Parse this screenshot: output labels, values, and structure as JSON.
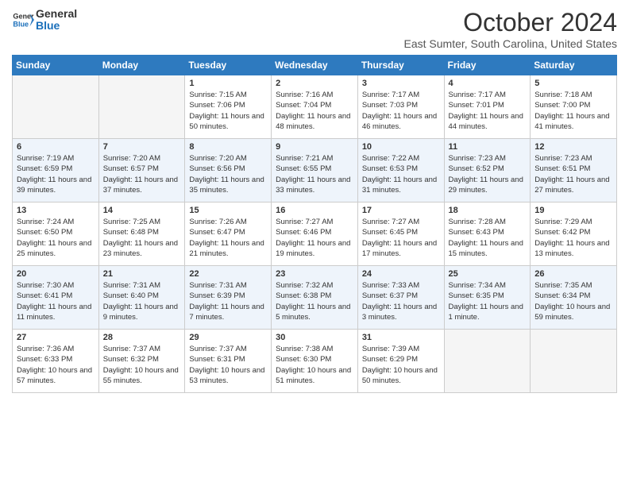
{
  "header": {
    "logo_line1": "General",
    "logo_line2": "Blue",
    "month_title": "October 2024",
    "subtitle": "East Sumter, South Carolina, United States"
  },
  "days_of_week": [
    "Sunday",
    "Monday",
    "Tuesday",
    "Wednesday",
    "Thursday",
    "Friday",
    "Saturday"
  ],
  "weeks": [
    [
      {
        "day": "",
        "info": ""
      },
      {
        "day": "",
        "info": ""
      },
      {
        "day": "1",
        "info": "Sunrise: 7:15 AM\nSunset: 7:06 PM\nDaylight: 11 hours and 50 minutes."
      },
      {
        "day": "2",
        "info": "Sunrise: 7:16 AM\nSunset: 7:04 PM\nDaylight: 11 hours and 48 minutes."
      },
      {
        "day": "3",
        "info": "Sunrise: 7:17 AM\nSunset: 7:03 PM\nDaylight: 11 hours and 46 minutes."
      },
      {
        "day": "4",
        "info": "Sunrise: 7:17 AM\nSunset: 7:01 PM\nDaylight: 11 hours and 44 minutes."
      },
      {
        "day": "5",
        "info": "Sunrise: 7:18 AM\nSunset: 7:00 PM\nDaylight: 11 hours and 41 minutes."
      }
    ],
    [
      {
        "day": "6",
        "info": "Sunrise: 7:19 AM\nSunset: 6:59 PM\nDaylight: 11 hours and 39 minutes."
      },
      {
        "day": "7",
        "info": "Sunrise: 7:20 AM\nSunset: 6:57 PM\nDaylight: 11 hours and 37 minutes."
      },
      {
        "day": "8",
        "info": "Sunrise: 7:20 AM\nSunset: 6:56 PM\nDaylight: 11 hours and 35 minutes."
      },
      {
        "day": "9",
        "info": "Sunrise: 7:21 AM\nSunset: 6:55 PM\nDaylight: 11 hours and 33 minutes."
      },
      {
        "day": "10",
        "info": "Sunrise: 7:22 AM\nSunset: 6:53 PM\nDaylight: 11 hours and 31 minutes."
      },
      {
        "day": "11",
        "info": "Sunrise: 7:23 AM\nSunset: 6:52 PM\nDaylight: 11 hours and 29 minutes."
      },
      {
        "day": "12",
        "info": "Sunrise: 7:23 AM\nSunset: 6:51 PM\nDaylight: 11 hours and 27 minutes."
      }
    ],
    [
      {
        "day": "13",
        "info": "Sunrise: 7:24 AM\nSunset: 6:50 PM\nDaylight: 11 hours and 25 minutes."
      },
      {
        "day": "14",
        "info": "Sunrise: 7:25 AM\nSunset: 6:48 PM\nDaylight: 11 hours and 23 minutes."
      },
      {
        "day": "15",
        "info": "Sunrise: 7:26 AM\nSunset: 6:47 PM\nDaylight: 11 hours and 21 minutes."
      },
      {
        "day": "16",
        "info": "Sunrise: 7:27 AM\nSunset: 6:46 PM\nDaylight: 11 hours and 19 minutes."
      },
      {
        "day": "17",
        "info": "Sunrise: 7:27 AM\nSunset: 6:45 PM\nDaylight: 11 hours and 17 minutes."
      },
      {
        "day": "18",
        "info": "Sunrise: 7:28 AM\nSunset: 6:43 PM\nDaylight: 11 hours and 15 minutes."
      },
      {
        "day": "19",
        "info": "Sunrise: 7:29 AM\nSunset: 6:42 PM\nDaylight: 11 hours and 13 minutes."
      }
    ],
    [
      {
        "day": "20",
        "info": "Sunrise: 7:30 AM\nSunset: 6:41 PM\nDaylight: 11 hours and 11 minutes."
      },
      {
        "day": "21",
        "info": "Sunrise: 7:31 AM\nSunset: 6:40 PM\nDaylight: 11 hours and 9 minutes."
      },
      {
        "day": "22",
        "info": "Sunrise: 7:31 AM\nSunset: 6:39 PM\nDaylight: 11 hours and 7 minutes."
      },
      {
        "day": "23",
        "info": "Sunrise: 7:32 AM\nSunset: 6:38 PM\nDaylight: 11 hours and 5 minutes."
      },
      {
        "day": "24",
        "info": "Sunrise: 7:33 AM\nSunset: 6:37 PM\nDaylight: 11 hours and 3 minutes."
      },
      {
        "day": "25",
        "info": "Sunrise: 7:34 AM\nSunset: 6:35 PM\nDaylight: 11 hours and 1 minute."
      },
      {
        "day": "26",
        "info": "Sunrise: 7:35 AM\nSunset: 6:34 PM\nDaylight: 10 hours and 59 minutes."
      }
    ],
    [
      {
        "day": "27",
        "info": "Sunrise: 7:36 AM\nSunset: 6:33 PM\nDaylight: 10 hours and 57 minutes."
      },
      {
        "day": "28",
        "info": "Sunrise: 7:37 AM\nSunset: 6:32 PM\nDaylight: 10 hours and 55 minutes."
      },
      {
        "day": "29",
        "info": "Sunrise: 7:37 AM\nSunset: 6:31 PM\nDaylight: 10 hours and 53 minutes."
      },
      {
        "day": "30",
        "info": "Sunrise: 7:38 AM\nSunset: 6:30 PM\nDaylight: 10 hours and 51 minutes."
      },
      {
        "day": "31",
        "info": "Sunrise: 7:39 AM\nSunset: 6:29 PM\nDaylight: 10 hours and 50 minutes."
      },
      {
        "day": "",
        "info": ""
      },
      {
        "day": "",
        "info": ""
      }
    ]
  ]
}
